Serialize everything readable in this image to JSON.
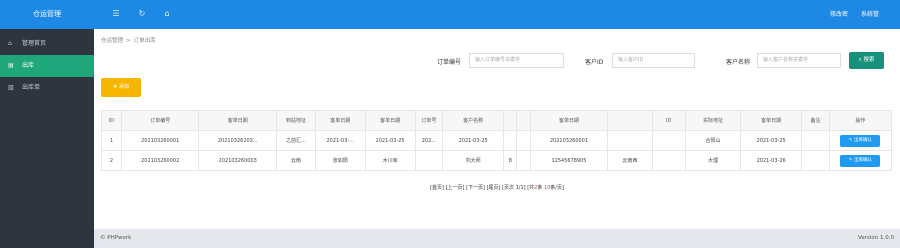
{
  "app": {
    "brand": "仓运管理"
  },
  "topbar": {
    "icons": [
      "menu-icon",
      "refresh-icon",
      "home-icon"
    ],
    "right_links": [
      "修改密",
      "系统管"
    ]
  },
  "sidebar": {
    "items": [
      {
        "label": "管理首页",
        "icon": "home-icon",
        "active": false
      },
      {
        "label": "出库",
        "icon": "list-icon",
        "active": true
      },
      {
        "label": "出库单",
        "icon": "doc-icon",
        "active": false
      }
    ]
  },
  "breadcrumb": [
    "仓运管理",
    "订单出库"
  ],
  "filters": {
    "order_no": {
      "label": "订单编号",
      "placeholder": "输入订单编号关键字"
    },
    "customer_id": {
      "label": "客户ID",
      "placeholder": "输入客户ID"
    },
    "customer_name": {
      "label": "客户名称",
      "placeholder": "输入客户名称关键字"
    },
    "search_label": "搜索"
  },
  "toolbar": {
    "add_label": "添加"
  },
  "table": {
    "headers": [
      "ID",
      "订单编号",
      "客单日期",
      "到站地址",
      "客单日期",
      "客单日期",
      "订单号",
      "客户名称",
      "",
      "",
      "客单日期",
      "",
      "ID",
      "实际地址",
      "客单日期",
      "备注",
      "操作"
    ],
    "rows": [
      {
        "cells": [
          "1",
          "202103260001",
          "20210326203...",
          "之前汇...",
          "2021-03-...",
          "2021-03-25",
          "202...",
          "2021-03-25",
          "",
          "",
          "202103260001",
          "",
          "",
          "合阳山",
          "2021-03-25",
          "",
          ""
        ],
        "action": "出库确认"
      },
      {
        "cells": [
          "2",
          "202103260002",
          "202103260003",
          "云南",
          "张如阳",
          "木川库",
          "",
          "刘大师",
          "8",
          "",
          "12545678905",
          "云南西",
          "",
          "大理",
          "2021-03-26",
          "",
          ""
        ],
        "action": "出库确认"
      }
    ]
  },
  "pager": {
    "first": "[首页]",
    "prev": "[上一页]",
    "next": "[下一页]",
    "last": "[尾页]",
    "info_prefix": "[页次 1/1] [共",
    "total": "2",
    "info_mid": "条 ",
    "per_page": "10",
    "info_suffix": "条/页]"
  },
  "footer": {
    "copyright": "© PHPwork",
    "version": "Version 1.0.0"
  }
}
